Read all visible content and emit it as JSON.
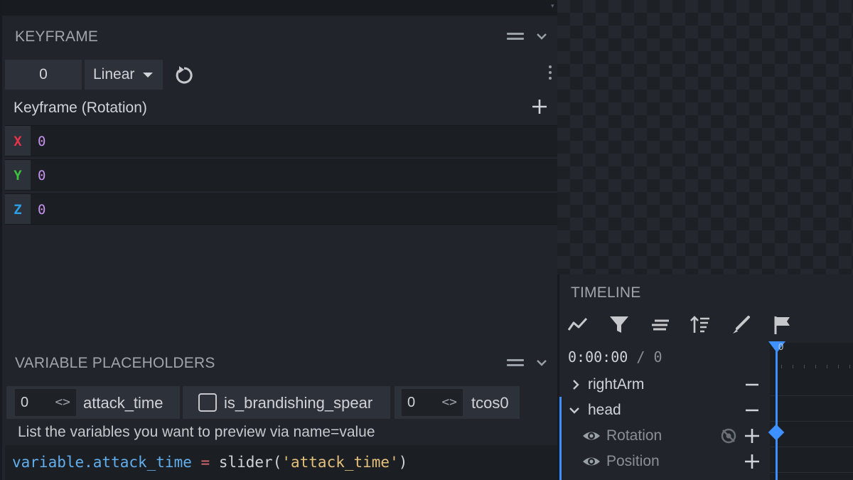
{
  "keyframe_panel": {
    "title": "KEYFRAME",
    "time_value": "0",
    "interpolation": "Linear",
    "channel_label": "Keyframe (Rotation)",
    "axes": [
      {
        "label": "X",
        "value": "0",
        "color": "#e8334a"
      },
      {
        "label": "Y",
        "value": "0",
        "color": "#3ec13e"
      },
      {
        "label": "Z",
        "value": "0",
        "color": "#2c9fe8"
      }
    ]
  },
  "variables_panel": {
    "title": "VARIABLE PLACEHOLDERS",
    "sliders": [
      {
        "value": "0",
        "arrows": "<>",
        "name": "attack_time"
      },
      {
        "value": "0",
        "arrows": "<>",
        "name": "tcos0"
      }
    ],
    "toggle": {
      "name": "is_brandishing_spear",
      "checked": false
    },
    "hint": "List the variables you want to preview via name=value",
    "code": {
      "ident": "variable.attack_time",
      "op": "=",
      "fn_open": "slider(",
      "str": "'attack_time'",
      "fn_close": ")"
    }
  },
  "timeline_panel": {
    "title": "TIMELINE",
    "tools": [
      "graph-icon",
      "filter-icon",
      "align-icon",
      "sort-icon",
      "brush-icon",
      "flag-icon"
    ],
    "time": {
      "timecode": "0:00:00",
      "separator": "/",
      "frame": "0"
    },
    "playhead_label": "0",
    "rows": [
      {
        "label": "rightArm",
        "kind": "group",
        "expanded": false
      },
      {
        "label": "head",
        "kind": "group",
        "expanded": true
      },
      {
        "label": "Rotation",
        "kind": "channel"
      },
      {
        "label": "Position",
        "kind": "channel"
      }
    ]
  },
  "colors": {
    "accent": "#3e90ff",
    "keyword_purple": "#c792ea",
    "string_yellow": "#e5c07b",
    "op_red": "#e06c75",
    "ident_blue": "#61afef"
  }
}
